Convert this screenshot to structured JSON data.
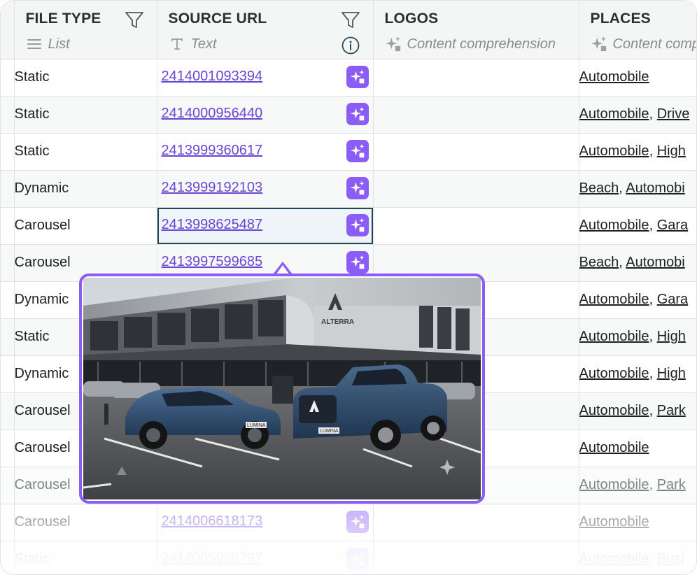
{
  "columns": [
    {
      "name": "FILE TYPE",
      "type": "List",
      "type_icon": "list-icon",
      "filter": true
    },
    {
      "name": "SOURCE URL",
      "type": "Text",
      "type_icon": "text-icon",
      "filter": true,
      "info": true
    },
    {
      "name": "LOGOS",
      "type": "Content comprehension",
      "type_icon": "sparkles-icon"
    },
    {
      "name": "PLACES",
      "type": "Content comprehension",
      "type_icon": "sparkles-icon"
    }
  ],
  "rows": [
    {
      "file_type": "Static",
      "url": "2414001093394",
      "places": [
        "Automobile"
      ]
    },
    {
      "file_type": "Static",
      "url": "2414000956440",
      "places": [
        "Automobile",
        "Drive"
      ]
    },
    {
      "file_type": "Static",
      "url": "2413999360617",
      "places": [
        "Automobile",
        "High"
      ]
    },
    {
      "file_type": "Dynamic",
      "url": "2413999192103",
      "places": [
        "Beach",
        "Automobi"
      ]
    },
    {
      "file_type": "Carousel",
      "url": "2413998625487",
      "places": [
        "Automobile",
        "Gara"
      ]
    },
    {
      "file_type": "Carousel",
      "url": "2413997599685",
      "places": [
        "Beach",
        "Automobi"
      ]
    },
    {
      "file_type": "Dynamic",
      "url": "",
      "places": [
        "Automobile",
        "Gara"
      ]
    },
    {
      "file_type": "Static",
      "url": "",
      "places": [
        "Automobile",
        "High"
      ]
    },
    {
      "file_type": "Dynamic",
      "url": "",
      "places": [
        "Automobile",
        "High"
      ]
    },
    {
      "file_type": "Carousel",
      "url": "",
      "places": [
        "Automobile",
        "Park"
      ]
    },
    {
      "file_type": "Carousel",
      "url": "",
      "places": [
        "Automobile"
      ]
    },
    {
      "file_type": "Carousel",
      "url": "",
      "places": [
        "Automobile",
        "Park"
      ]
    },
    {
      "file_type": "Carousel",
      "url": "2414006618173",
      "places": [
        "Automobile"
      ]
    },
    {
      "file_type": "Static",
      "url": "2414005998797",
      "places": [
        "Automobile",
        "Busi"
      ]
    }
  ],
  "active_row": 4,
  "preview": {
    "building_sign": "ALTERRA",
    "plate_sedan": "LUMINA",
    "plate_truck": "LUMINA"
  },
  "colors": {
    "accent": "#8b5cf6",
    "link": "#6a45d6",
    "header_bg": "#f4f5f5",
    "active_border": "#1d4657"
  }
}
